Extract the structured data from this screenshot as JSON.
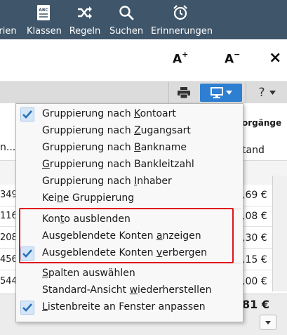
{
  "toolbar": {
    "items": [
      {
        "label": "rien",
        "icon": "calendar-icon"
      },
      {
        "label": "Klassen",
        "icon": "abc-list-icon"
      },
      {
        "label": "Regeln",
        "icon": "shuffle-icon"
      },
      {
        "label": "Suchen",
        "icon": "search-icon"
      },
      {
        "label": "Erinnerungen",
        "icon": "alarm-clock-icon"
      }
    ]
  },
  "font_controls": {
    "increase": "A",
    "increase_sup": "+",
    "decrease": "A",
    "decrease_sup": "−",
    "close": "×"
  },
  "action_bar": {
    "help_label": "?"
  },
  "background_table": {
    "right_header": "orgänge",
    "left_col_header": "n...",
    "right_col_header": "tand",
    "rows": [
      {
        "left": "349",
        "right": ",69 €"
      },
      {
        "left": "116",
        "right": ",08 €"
      },
      {
        "left": "208",
        "right": ",30 €"
      },
      {
        "left": "456",
        "right": ",15 €"
      },
      {
        "left": "544",
        "right": ",00 €"
      }
    ],
    "total": "81 €"
  },
  "menu": {
    "items": [
      {
        "pre": "Gruppierung nach ",
        "ul": "K",
        "post": "ontoart",
        "checked": true
      },
      {
        "pre": "Gruppierung nach ",
        "ul": "Z",
        "post": "ugangsart",
        "checked": false
      },
      {
        "pre": "Gruppierung nach ",
        "ul": "B",
        "post": "ankname",
        "checked": false
      },
      {
        "pre": "",
        "ul": "G",
        "post": "ruppierung nach Bankleitzahl",
        "checked": false
      },
      {
        "pre": "Gruppierung nach ",
        "ul": "I",
        "post": "nhaber",
        "checked": false
      },
      {
        "pre": "Kei",
        "ul": "n",
        "post": "e Gruppierung",
        "checked": false
      },
      {
        "pre": "Kon",
        "ul": "t",
        "post": "o ausblenden",
        "checked": false
      },
      {
        "pre": "Ausgeblendete Konten ",
        "ul": "a",
        "post": "nzeigen",
        "checked": false
      },
      {
        "pre": "Ausgeblendete Konten ",
        "ul": "v",
        "post": "erbergen",
        "checked": true
      },
      {
        "pre": "",
        "ul": "S",
        "post": "palten auswählen",
        "checked": false
      },
      {
        "pre": "Standard-Ansicht ",
        "ul": "w",
        "post": "iederherstellen",
        "checked": false
      },
      {
        "pre": "",
        "ul": "L",
        "post": "istenbreite an Fenster anpassen",
        "checked": true
      }
    ]
  },
  "colors": {
    "toolbar_bg": "#3f5569",
    "accent_blue": "#2e7fd1",
    "highlight_red": "#e0141e",
    "check_blue": "#2a6fb8"
  }
}
